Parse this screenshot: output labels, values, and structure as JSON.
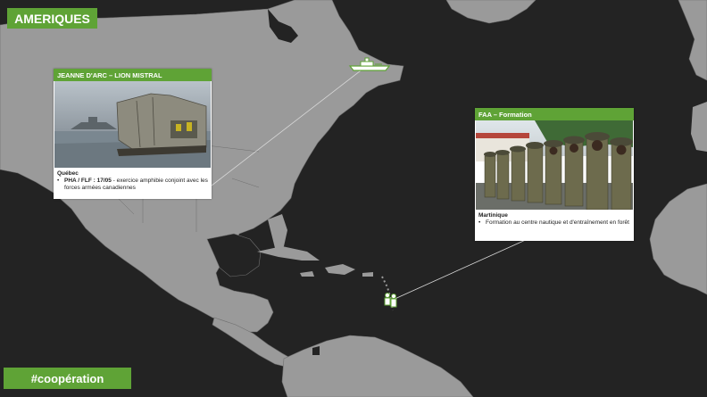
{
  "region": {
    "title": "AMERIQUES"
  },
  "hashtag": "#coopération",
  "cards": {
    "quebec": {
      "title": "JEANNE D'ARC – LION MISTRAL",
      "place": "Québec",
      "bullet_bold": "PHA / FLF : 17/05",
      "bullet_text": " - exercice amphibie conjoint avec les forces armées canadiennes"
    },
    "faa": {
      "title": "FAA – Formation",
      "place": "Martinique",
      "bullet_text": "Formation au centre nautique et d'entraînement en forêt"
    }
  },
  "markers": {
    "quebec": {
      "icon": "warship-icon"
    },
    "martinique": {
      "icon": "soldiers-icon"
    }
  },
  "colors": {
    "accent": "#5fa336",
    "land": "#9a9a9a",
    "sea": "#232323"
  }
}
